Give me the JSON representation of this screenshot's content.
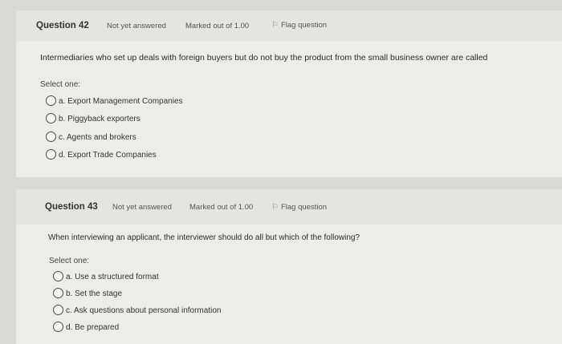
{
  "questions": [
    {
      "label": "Question 42",
      "status": "Not yet answered",
      "marks": "Marked out of 1.00",
      "flag": "Flag question",
      "text": "Intermediaries who set up deals with foreign buyers but do not buy the product from the small business owner are called",
      "select_label": "Select one:",
      "options": [
        "a. Export Management Companies",
        "b. Piggyback exporters",
        "c. Agents and brokers",
        "d. Export Trade Companies"
      ]
    },
    {
      "label": "Question 43",
      "status": "Not yet answered",
      "marks": "Marked out of 1.00",
      "flag": "Flag question",
      "text": "When interviewing an applicant, the interviewer should do all but which of the following?",
      "select_label": "Select one:",
      "options": [
        "a. Use a structured format",
        "b. Set the stage",
        "c. Ask questions about personal information",
        "d. Be prepared"
      ]
    }
  ],
  "icons": {
    "flag": "flag-icon",
    "radio": "radio-button-icon"
  }
}
